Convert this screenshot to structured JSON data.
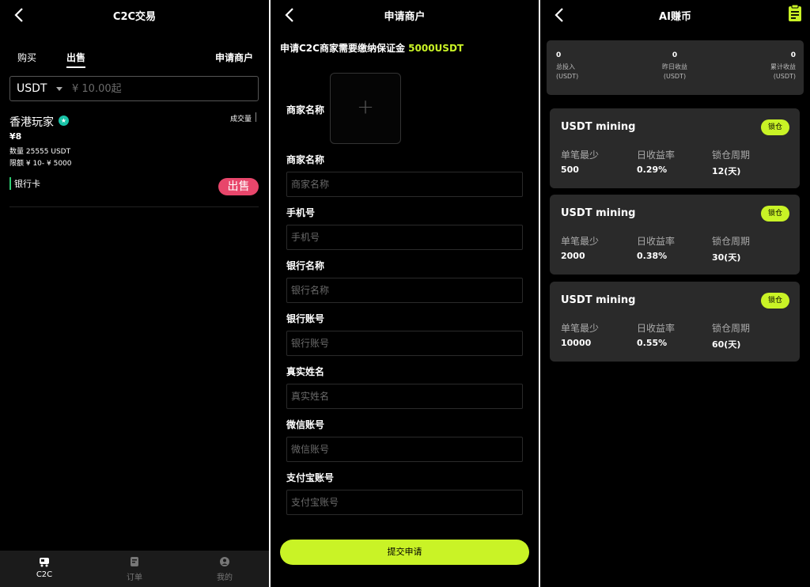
{
  "c2c": {
    "title": "C2C交易",
    "tabs": [
      "购买",
      "出售"
    ],
    "apply_link": "申请商户",
    "search": {
      "currency": "USDT",
      "placeholder": "¥ 10.00起"
    },
    "listing": {
      "merchant": "香港玩家",
      "volume_label": "成交量",
      "price": "¥8",
      "quantity": "数量 25555 USDT",
      "limit": "限额 ¥ 10- ¥ 5000",
      "payment": "银行卡",
      "sell_button": "出售"
    },
    "nav": [
      {
        "label": "C2C",
        "icon": "c2c-icon"
      },
      {
        "label": "订单",
        "icon": "order-icon"
      },
      {
        "label": "我的",
        "icon": "profile-icon"
      }
    ]
  },
  "apply": {
    "title": "申请商户",
    "notice": "申请C2C商家需要缴纳保证金",
    "deposit": "5000USDT",
    "logo_label": "商家名称",
    "fields": [
      {
        "label": "商家名称",
        "placeholder": "商家名称"
      },
      {
        "label": "手机号",
        "placeholder": "手机号"
      },
      {
        "label": "银行名称",
        "placeholder": "银行名称"
      },
      {
        "label": "银行账号",
        "placeholder": "银行账号"
      },
      {
        "label": "真实姓名",
        "placeholder": "真实姓名"
      },
      {
        "label": "微信账号",
        "placeholder": "微信账号"
      },
      {
        "label": "支付宝账号",
        "placeholder": "支付宝账号"
      }
    ],
    "submit": "提交申请"
  },
  "ai": {
    "title": "AI赚币",
    "stats": [
      {
        "value": "0",
        "label": "总投入",
        "unit": "(USDT)"
      },
      {
        "value": "0",
        "label": "昨日收益",
        "unit": "(USDT)"
      },
      {
        "value": "0",
        "label": "累计收益",
        "unit": "(USDT)"
      }
    ],
    "headers": [
      "单笔最少",
      "日收益率",
      "锁仓周期"
    ],
    "lock_label": "锁仓",
    "products": [
      {
        "name": "USDT mining",
        "min": "500",
        "rate": "0.29%",
        "period": "12(天)"
      },
      {
        "name": "USDT mining",
        "min": "2000",
        "rate": "0.38%",
        "period": "30(天)"
      },
      {
        "name": "USDT mining",
        "min": "10000",
        "rate": "0.55%",
        "period": "60(天)"
      }
    ]
  },
  "colors": {
    "accent": "#c9f326",
    "sell": "#e8466b",
    "badge": "#19c3a7",
    "card": "#2a2a2a"
  }
}
